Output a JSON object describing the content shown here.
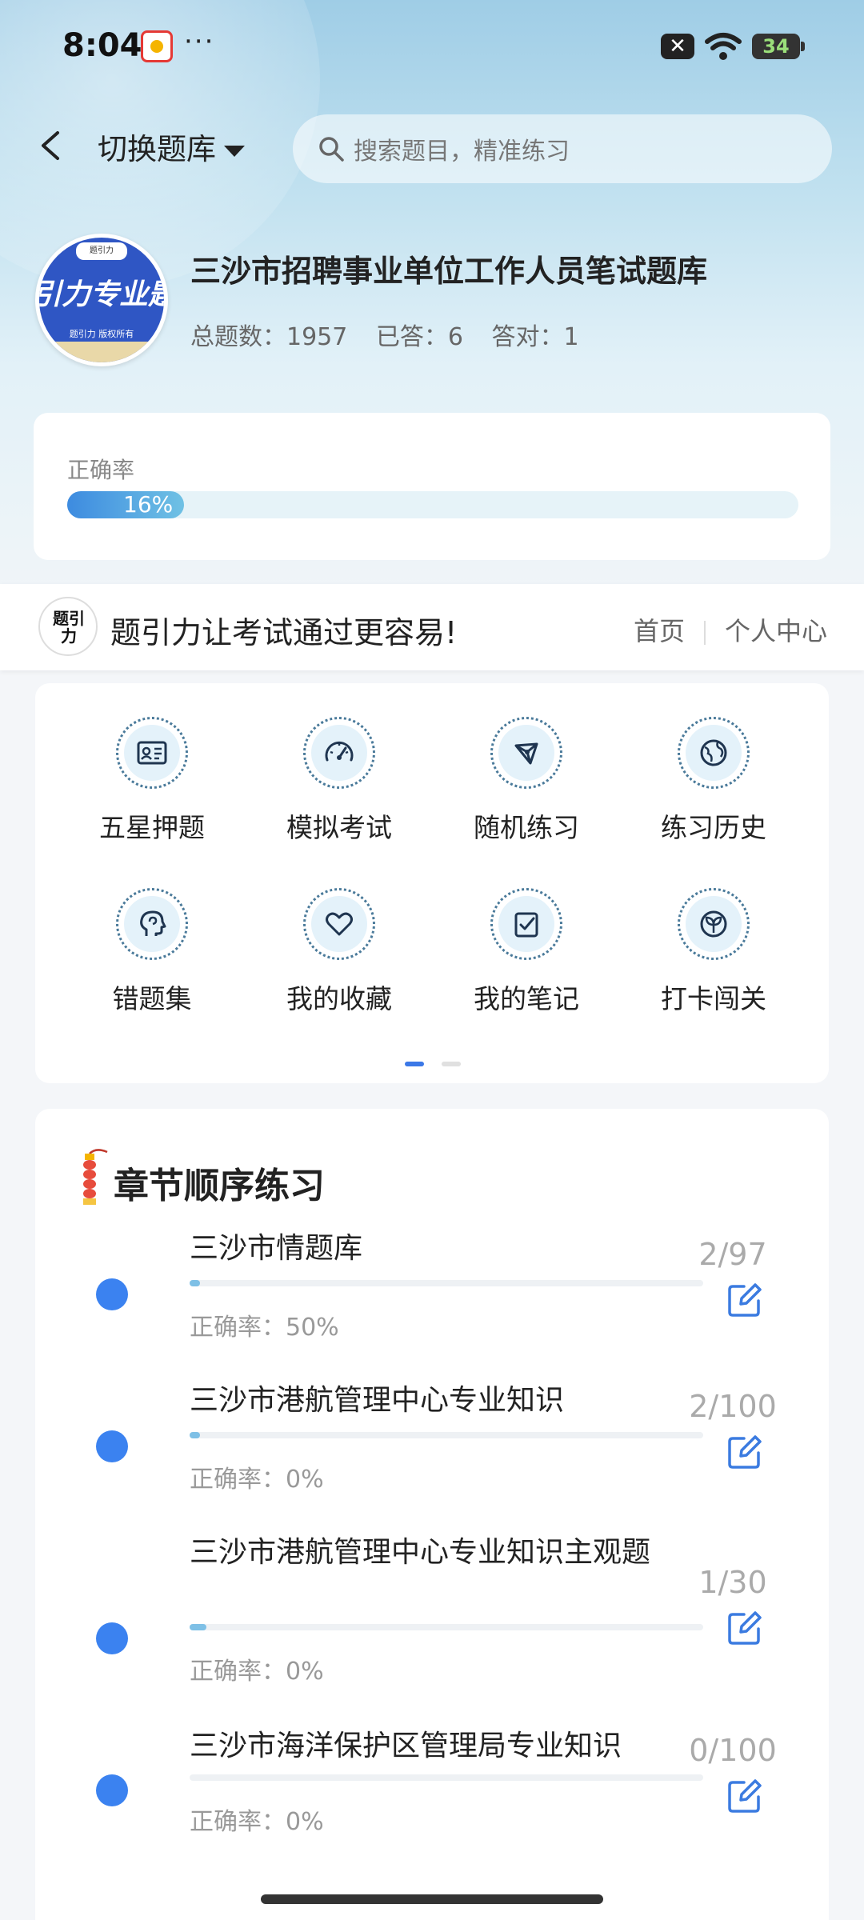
{
  "status_bar": {
    "time": "8:04",
    "more": "···",
    "battery": "34"
  },
  "header": {
    "switch_label": "切换题库",
    "search_placeholder": "搜索题目，精准练习"
  },
  "library": {
    "logo_top": "题引力",
    "logo_main": "引力专业题",
    "logo_sub": "题引力 版权所有",
    "title": "三沙市招聘事业单位工作人员笔试题库",
    "stats": [
      {
        "label": "总题数：",
        "value": "1957"
      },
      {
        "label": "已答：",
        "value": "6"
      },
      {
        "label": "答对：",
        "value": "1"
      }
    ]
  },
  "accuracy": {
    "label": "正确率",
    "percent_text": "16%",
    "fraction": 0.16
  },
  "banner": {
    "logo_text": "题引力",
    "slogan": "题引力让考试通过更容易!",
    "nav": [
      "首页",
      "个人中心"
    ]
  },
  "features": [
    {
      "label": "五星押题",
      "icon": "id-card-icon"
    },
    {
      "label": "模拟考试",
      "icon": "speedometer-icon"
    },
    {
      "label": "随机练习",
      "icon": "network-icon"
    },
    {
      "label": "练习历史",
      "icon": "globe-icon"
    },
    {
      "label": "错题集",
      "icon": "head-icon"
    },
    {
      "label": "我的收藏",
      "icon": "heart-icon"
    },
    {
      "label": "我的笔记",
      "icon": "checklist-icon"
    },
    {
      "label": "打卡闯关",
      "icon": "sprout-icon"
    }
  ],
  "pager": {
    "pages": 2,
    "active": 0
  },
  "chapters": {
    "title": "章节顺序练习",
    "items": [
      {
        "name": "三沙市情题库",
        "accuracy": "正确率：50%",
        "count": "2/97",
        "progress": 0.0206
      },
      {
        "name": "三沙市港航管理中心专业知识",
        "accuracy": "正确率：0%",
        "count": "2/100",
        "progress": 0.02
      },
      {
        "name": "三沙市港航管理中心专业知识主观题",
        "accuracy": "正确率：0%",
        "count": "1/30",
        "progress": 0.0333
      },
      {
        "name": "三沙市海洋保护区管理局专业知识",
        "accuracy": "正确率：0%",
        "count": "0/100",
        "progress": 0
      }
    ]
  }
}
